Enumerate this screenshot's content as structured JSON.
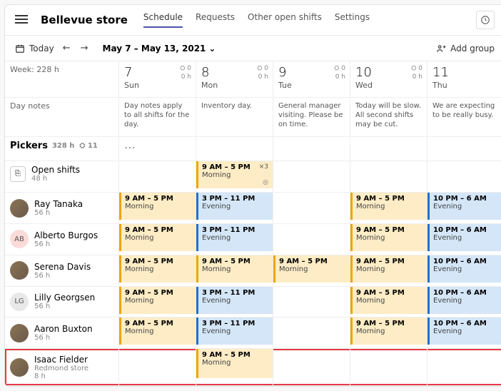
{
  "header": {
    "title": "Bellevue store"
  },
  "tabs": [
    {
      "label": "Schedule",
      "active": true
    },
    {
      "label": "Requests"
    },
    {
      "label": "Other open shifts"
    },
    {
      "label": "Settings"
    }
  ],
  "toolbar": {
    "today": "Today",
    "range": "May 7 – May 13, 2021",
    "addGroup": "Add group"
  },
  "weekLabel": "Week: 228 h",
  "dayNotesLabel": "Day notes",
  "days": [
    {
      "num": "7",
      "abbr": "Sun",
      "people": "0",
      "hours": "0 h",
      "note": "Day notes apply to all shifts for the day."
    },
    {
      "num": "8",
      "abbr": "Mon",
      "people": "0",
      "hours": "0 h",
      "note": "Inventory day."
    },
    {
      "num": "9",
      "abbr": "Tue",
      "people": "0",
      "hours": "0 h",
      "note": "General manager visiting. Please be on time."
    },
    {
      "num": "10",
      "abbr": "Wed",
      "people": "0",
      "hours": "0 h",
      "note": "Today will be slow. All second shifts may be cut."
    },
    {
      "num": "11",
      "abbr": "Thu",
      "people": "",
      "hours": "",
      "note": "We are expecting to be really busy."
    }
  ],
  "group": {
    "name": "Pickers",
    "hours": "328 h",
    "people": "11"
  },
  "openShifts": {
    "label": "Open shifts",
    "hours": "48 h"
  },
  "shifts": {
    "morning": {
      "time": "9 AM – 5 PM",
      "label": "Morning"
    },
    "evening3": {
      "time": "3 PM – 11 PM",
      "label": "Evening"
    },
    "evening10": {
      "time": "10 PM – 6 AM",
      "label": "Evening"
    }
  },
  "openShiftBadge": "×3",
  "people": [
    {
      "name": "Ray Tanaka",
      "hours": "56 h",
      "avatar": "photo",
      "shifts": [
        "morning",
        "evening3",
        "",
        "morning",
        "evening10"
      ]
    },
    {
      "name": "Alberto Burgos",
      "hours": "56 h",
      "initials": "AB",
      "avatar": "pink",
      "shifts": [
        "morning",
        "evening3",
        "",
        "morning",
        "evening10"
      ]
    },
    {
      "name": "Serena Davis",
      "hours": "56 h",
      "avatar": "photo",
      "shifts": [
        "morning",
        "morning",
        "morning",
        "morning",
        "evening10"
      ]
    },
    {
      "name": "Lilly Georgsen",
      "hours": "56 h",
      "initials": "LG",
      "avatar": "gray",
      "shifts": [
        "morning",
        "evening3",
        "",
        "morning",
        "evening10"
      ]
    },
    {
      "name": "Aaron Buxton",
      "hours": "56 h",
      "avatar": "photo",
      "shifts": [
        "morning",
        "evening3",
        "",
        "morning",
        "evening10"
      ]
    },
    {
      "name": "Isaac Fielder",
      "subtitle": "Redmond store",
      "hours": "8 h",
      "avatar": "photo",
      "shifts": [
        "",
        "morning",
        "",
        "",
        ""
      ],
      "highlight": true
    }
  ]
}
